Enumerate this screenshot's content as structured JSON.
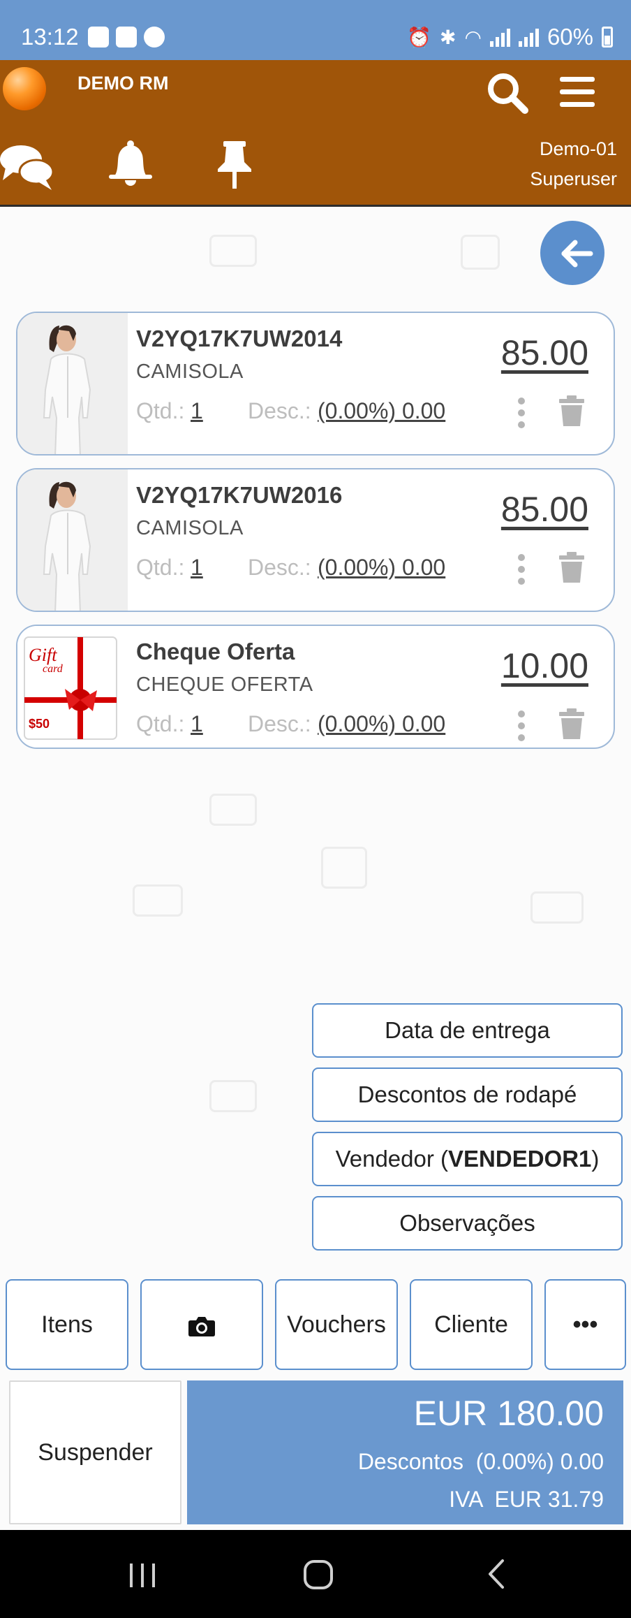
{
  "status_bar": {
    "time": "13:12",
    "battery": "60%"
  },
  "header": {
    "app_name": "DEMO RM",
    "store": "Demo-01",
    "user": "Superuser"
  },
  "cart_items": [
    {
      "code": "V2YQ17K7UW2014",
      "description": "CAMISOLA",
      "qty_label": "Qtd.:",
      "qty": "1",
      "discount_label": "Desc.:",
      "discount": "(0.00%) 0.00",
      "price": "85.00",
      "image": "white-sweater-model"
    },
    {
      "code": "V2YQ17K7UW2016",
      "description": "CAMISOLA",
      "qty_label": "Qtd.:",
      "qty": "1",
      "discount_label": "Desc.:",
      "discount": "(0.00%) 0.00",
      "price": "85.00",
      "image": "white-sweater-model"
    },
    {
      "code": "Cheque Oferta",
      "description": "CHEQUE OFERTA",
      "qty_label": "Qtd.:",
      "qty": "1",
      "discount_label": "Desc.:",
      "discount": "(0.00%) 0.00",
      "price": "10.00",
      "image": "gift-card",
      "gift_card": {
        "line1": "Gift",
        "line2": "card",
        "amount": "$50"
      }
    }
  ],
  "options": {
    "delivery_date": "Data de entrega",
    "footer_discounts": "Descontos de rodapé",
    "seller_prefix": "Vendedor (",
    "seller_name": "VENDEDOR1",
    "seller_suffix": ")",
    "notes": "Observações"
  },
  "toolbar": {
    "items": "Itens",
    "camera": "camera-icon",
    "vouchers": "Vouchers",
    "client": "Cliente",
    "more": "•••"
  },
  "footer": {
    "suspend": "Suspender",
    "total": "EUR 180.00",
    "discounts": "Descontos  (0.00%) 0.00",
    "vat": "IVA  EUR 31.79"
  },
  "colors": {
    "status_bar": "#6a98cf",
    "header": "#a05509",
    "accent": "#5b8fcd",
    "totals": "#6a98cf"
  }
}
